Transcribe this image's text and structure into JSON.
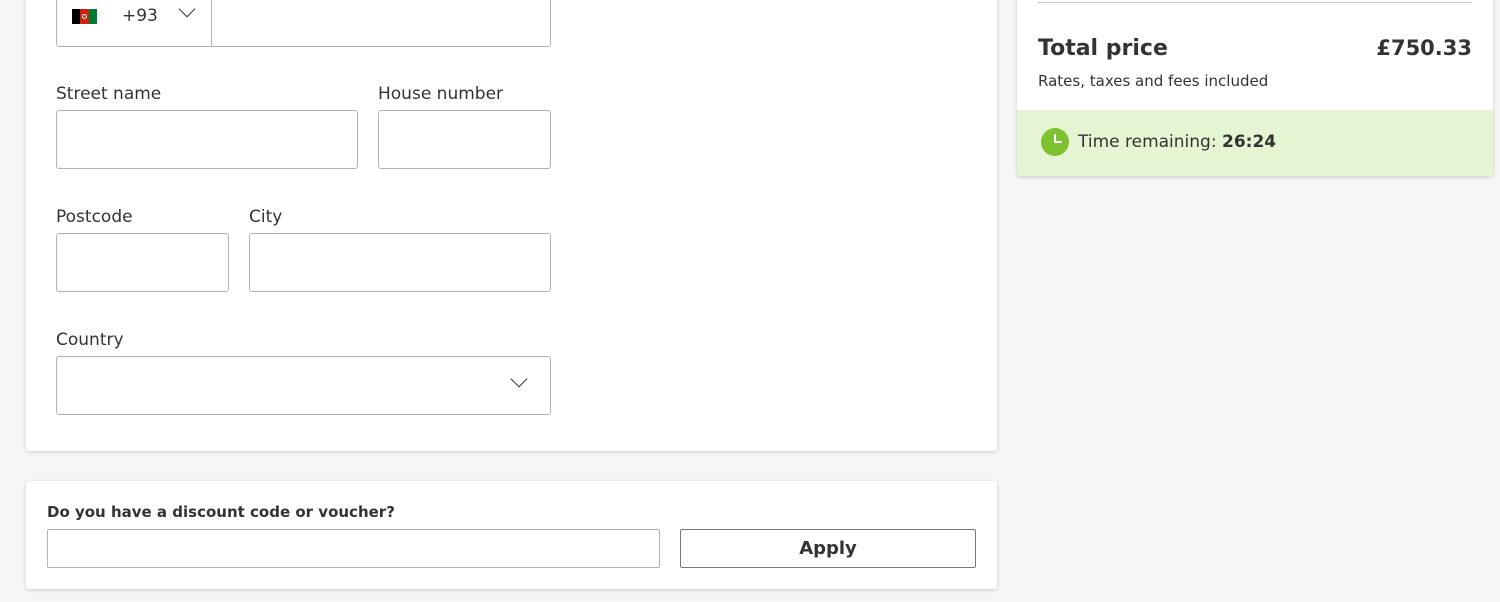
{
  "phone": {
    "country_code": "+93",
    "flag_colors": [
      "#000000",
      "#d32011",
      "#007a36"
    ]
  },
  "address": {
    "street_label": "Street name",
    "house_label": "House number",
    "postcode_label": "Postcode",
    "city_label": "City",
    "country_label": "Country"
  },
  "discount": {
    "label": "Do you have a discount code or voucher?",
    "apply_label": "Apply"
  },
  "summary": {
    "total_label": "Total price",
    "total_value": "£750.33",
    "total_note": "Rates, taxes and fees included",
    "timer_label": "Time remaining: ",
    "timer_value": "26:24",
    "timer_accent": "#7dc22e",
    "timer_bg": "#e5f4d3"
  }
}
